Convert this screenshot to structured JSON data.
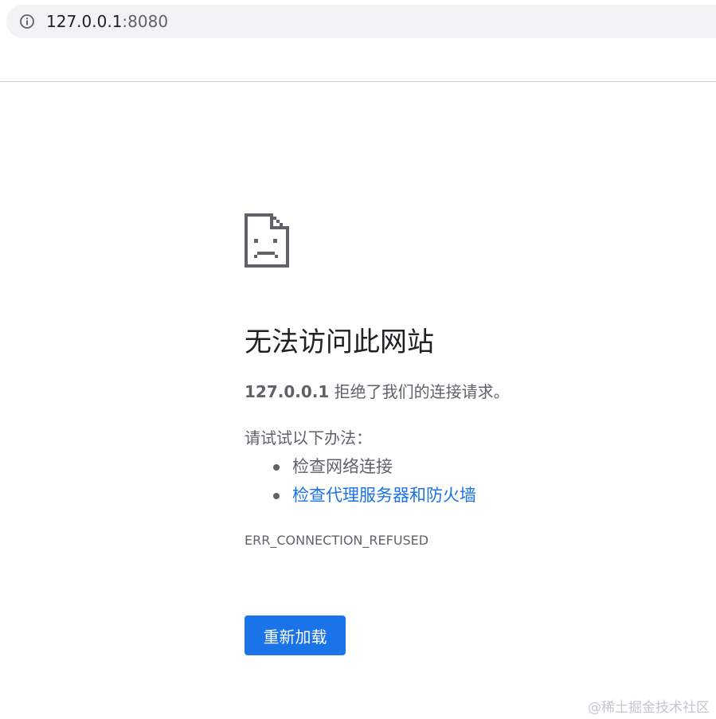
{
  "address_bar": {
    "host": "127.0.0.1",
    "port": ":8080",
    "icon": "info-icon"
  },
  "error": {
    "icon": "sad-page-icon",
    "title": "无法访问此网站",
    "message_host": "127.0.0.1",
    "message_text": " 拒绝了我们的连接请求。",
    "suggestions_heading": "请试试以下办法：",
    "suggestions": [
      {
        "label": "检查网络连接",
        "link": false
      },
      {
        "label": "检查代理服务器和防火墙",
        "link": true
      }
    ],
    "code": "ERR_CONNECTION_REFUSED",
    "reload_label": "重新加载"
  },
  "watermark": "@稀土掘金技术社区",
  "colors": {
    "accent": "#1a73e8",
    "text_primary": "#202124",
    "text_secondary": "#5f6368",
    "omnibox_bg": "#f1f3f4"
  }
}
